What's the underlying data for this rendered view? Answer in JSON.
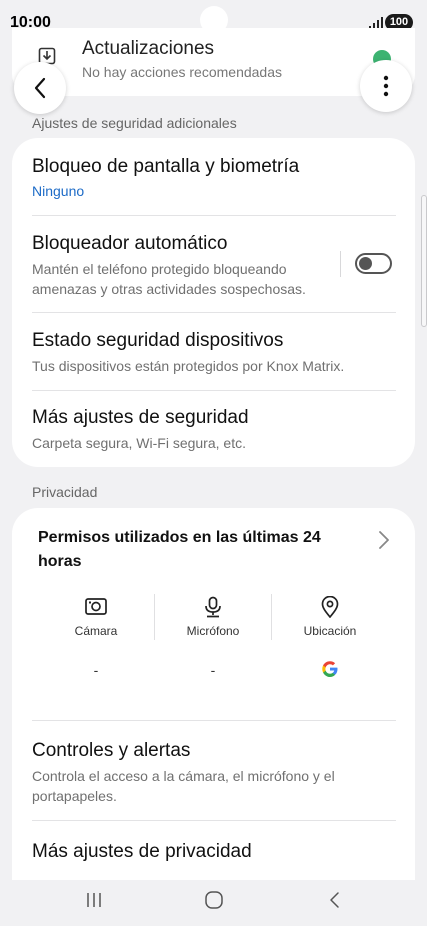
{
  "status_bar": {
    "time": "10:00",
    "battery": "100"
  },
  "update_card": {
    "title": "Actualizaciones",
    "subtitle": "No hay acciones recomendadas"
  },
  "security": {
    "section_label": "Ajustes de seguridad adicionales",
    "items": [
      {
        "title": "Bloqueo de pantalla y biometría",
        "subtitle": "Ninguno"
      },
      {
        "title": "Bloqueador automático",
        "subtitle": "Mantén el teléfono protegido bloqueando amenazas y otras actividades sospechosas.",
        "toggle_on": false
      },
      {
        "title": "Estado seguridad dispositivos",
        "subtitle": "Tus dispositivos están protegidos por Knox Matrix."
      },
      {
        "title": "Más ajustes de seguridad",
        "subtitle": "Carpeta segura, Wi-Fi segura, etc."
      }
    ]
  },
  "privacy": {
    "section_label": "Privacidad",
    "permissions_title": "Permisos utilizados en las últimas 24 horas",
    "permissions": [
      {
        "label": "Cámara",
        "value": "-",
        "icon": "camera-icon"
      },
      {
        "label": "Micrófono",
        "value": "-",
        "icon": "microphone-icon"
      },
      {
        "label": "Ubicación",
        "value": "",
        "icon": "location-icon",
        "app_icon": "google-icon"
      }
    ],
    "items": [
      {
        "title": "Controles y alertas",
        "subtitle": "Controla el acceso a la cámara, el micrófono y el portapapeles."
      },
      {
        "title": "Más ajustes de privacidad"
      }
    ]
  },
  "icons": {
    "back": "chevron-left-icon",
    "more": "more-vertical-icon",
    "nav": [
      "recent-apps-icon",
      "home-icon",
      "back-nav-icon"
    ]
  },
  "colors": {
    "link_blue": "#1d6bc7",
    "check_green": "#3cb371",
    "background": "#f1f1f3"
  }
}
